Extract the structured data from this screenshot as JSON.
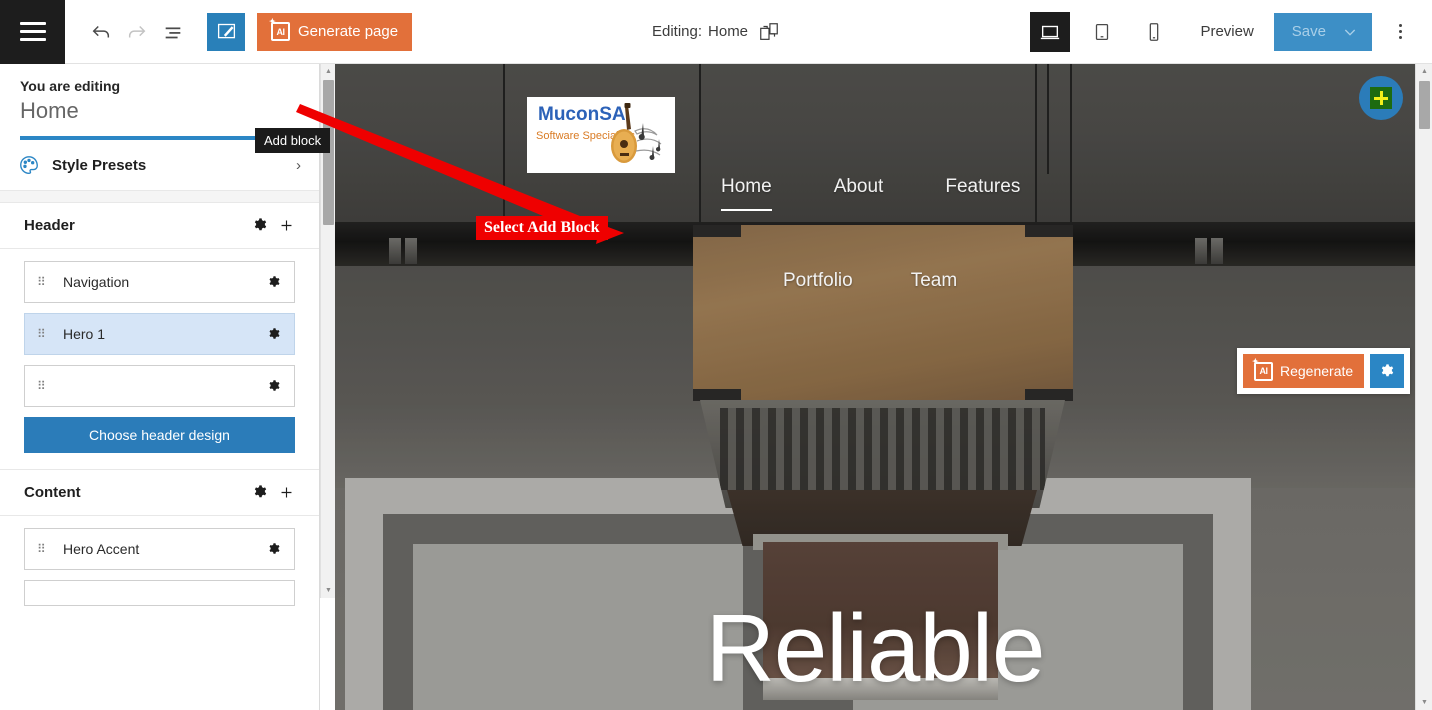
{
  "toolbar": {
    "menu_icon": "hamburger-icon",
    "undo_icon": "undo-arrow-icon",
    "redo_icon": "redo-arrow-icon",
    "outline_icon": "outline-list-icon",
    "edit_icon": "edit-page-icon",
    "generate_label": "Generate page",
    "generate_icon": "ai-sparkle-icon",
    "generate_color": "#e2703a",
    "editing_label": "Editing:",
    "editing_page": "Home",
    "page_switch_icon": "switch-page-icon",
    "device_desktop_icon": "desktop-icon",
    "device_tablet_icon": "tablet-icon",
    "device_mobile_icon": "mobile-icon",
    "preview_label": "Preview",
    "save_label": "Save",
    "save_dropdown_icon": "chevron-down-icon",
    "save_color": "#3d8fc6",
    "more_icon": "kebab-menu-icon"
  },
  "sidebar": {
    "you_are_editing": "You are editing",
    "page_name": "Home",
    "accent_color": "#2b86c5",
    "add_block_icon": "plus-icon",
    "add_block_tooltip": "Add block",
    "style_presets": {
      "label": "Style Presets",
      "icon": "palette-icon",
      "chevron": "›"
    },
    "sections": [
      {
        "title": "Header",
        "gear_icon": "gear-icon",
        "add_icon": "plus-icon",
        "blocks": [
          {
            "label": "Navigation",
            "selected": false
          },
          {
            "label": "Hero 1",
            "selected": true
          },
          {
            "label": "",
            "selected": false
          }
        ],
        "action_label": "Choose header design"
      },
      {
        "title": "Content",
        "gear_icon": "gear-icon",
        "add_icon": "plus-icon",
        "blocks": [
          {
            "label": "Hero Accent",
            "selected": false
          },
          {
            "label": "",
            "selected": false
          }
        ],
        "action_label": ""
      }
    ],
    "scrollbar": {
      "up_arrow": "▲",
      "down_arrow": "▼"
    }
  },
  "annotation": {
    "label": "Select Add Block",
    "color": "#ef0000"
  },
  "canvas": {
    "logo": {
      "title": "MuconSA",
      "subtitle": "Software Specialists",
      "title_color": "#2c62b8",
      "subtitle_color": "#d97b24",
      "graphic": "acoustic-guitar-and-music-notes"
    },
    "nav_row1": [
      {
        "label": "Home",
        "active": true
      },
      {
        "label": "About",
        "active": false
      },
      {
        "label": "Features",
        "active": false
      }
    ],
    "nav_row2": [
      {
        "label": "Portfolio",
        "active": false
      },
      {
        "label": "Team",
        "active": false
      }
    ],
    "hero_title": "Reliable",
    "regenerate": {
      "label": "Regenerate",
      "icon": "ai-sparkle-icon",
      "gear_icon": "gear-icon",
      "button_color": "#e2703a",
      "gear_color": "#2b86c5"
    },
    "scrollbar": {
      "up_arrow": "▲",
      "down_arrow": "▼"
    }
  }
}
